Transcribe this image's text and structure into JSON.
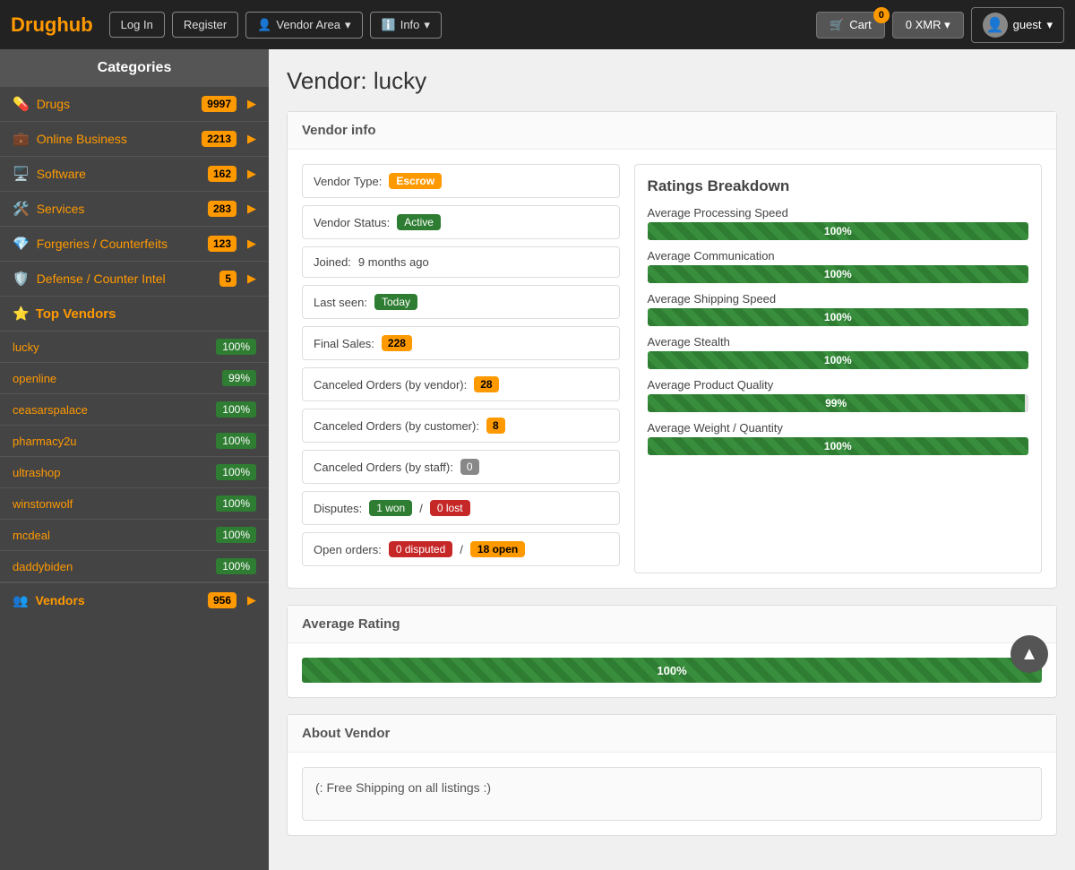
{
  "navbar": {
    "brand_drug": "Drug",
    "brand_hub": "hub",
    "login_label": "Log In",
    "register_label": "Register",
    "vendor_area_label": "Vendor Area",
    "info_label": "Info",
    "cart_label": "Cart",
    "cart_badge": "0",
    "xmr_label": "0 XMR",
    "guest_label": "guest"
  },
  "sidebar": {
    "title": "Categories",
    "items": [
      {
        "label": "Drugs",
        "badge": "9997",
        "icon": "💊"
      },
      {
        "label": "Online Business",
        "badge": "2213",
        "icon": "💼"
      },
      {
        "label": "Software",
        "badge": "162",
        "icon": "🖥️"
      },
      {
        "label": "Services",
        "badge": "283",
        "icon": "🛠️"
      },
      {
        "label": "Forgeries / Counterfeits",
        "badge": "123",
        "icon": "💎"
      },
      {
        "label": "Defense / Counter Intel",
        "badge": "5",
        "icon": "🛡️"
      }
    ],
    "top_vendors_title": "Top Vendors",
    "vendors": [
      {
        "name": "lucky",
        "pct": "100%"
      },
      {
        "name": "openline",
        "pct": "99%"
      },
      {
        "name": "ceasarspalace",
        "pct": "100%"
      },
      {
        "name": "pharmacy2u",
        "pct": "100%"
      },
      {
        "name": "ultrashop",
        "pct": "100%"
      },
      {
        "name": "winstonwolf",
        "pct": "100%"
      },
      {
        "name": "mcdeal",
        "pct": "100%"
      },
      {
        "name": "daddybiden",
        "pct": "100%"
      }
    ],
    "vendors_footer_label": "Vendors",
    "vendors_footer_badge": "956"
  },
  "page": {
    "title": "Vendor: lucky"
  },
  "vendor_info": {
    "section_title": "Vendor info",
    "vendor_type_label": "Vendor Type:",
    "vendor_type_value": "Escrow",
    "vendor_status_label": "Vendor Status:",
    "vendor_status_value": "Active",
    "joined_label": "Joined:",
    "joined_value": "9 months ago",
    "last_seen_label": "Last seen:",
    "last_seen_value": "Today",
    "final_sales_label": "Final Sales:",
    "final_sales_value": "228",
    "canceled_vendor_label": "Canceled Orders (by vendor):",
    "canceled_vendor_value": "28",
    "canceled_customer_label": "Canceled Orders (by customer):",
    "canceled_customer_value": "8",
    "canceled_staff_label": "Canceled Orders (by staff):",
    "canceled_staff_value": "0",
    "disputes_label": "Disputes:",
    "disputes_won": "1 won",
    "disputes_sep": "/",
    "disputes_lost": "0 lost",
    "open_orders_label": "Open orders:",
    "open_disputed": "0 disputed",
    "open_sep": "/",
    "open_open": "18 open"
  },
  "ratings": {
    "title": "Ratings Breakdown",
    "items": [
      {
        "label": "Average Processing Speed",
        "pct": 100,
        "pct_label": "100%"
      },
      {
        "label": "Average Communication",
        "pct": 100,
        "pct_label": "100%"
      },
      {
        "label": "Average Shipping Speed",
        "pct": 100,
        "pct_label": "100%"
      },
      {
        "label": "Average Stealth",
        "pct": 100,
        "pct_label": "100%"
      },
      {
        "label": "Average Product Quality",
        "pct": 99,
        "pct_label": "99%"
      },
      {
        "label": "Average Weight / Quantity",
        "pct": 100,
        "pct_label": "100%"
      }
    ]
  },
  "average_rating": {
    "title": "Average Rating",
    "pct_label": "100%",
    "pct": 100
  },
  "about_vendor": {
    "title": "About Vendor",
    "text": "(: Free Shipping on all listings :)"
  }
}
